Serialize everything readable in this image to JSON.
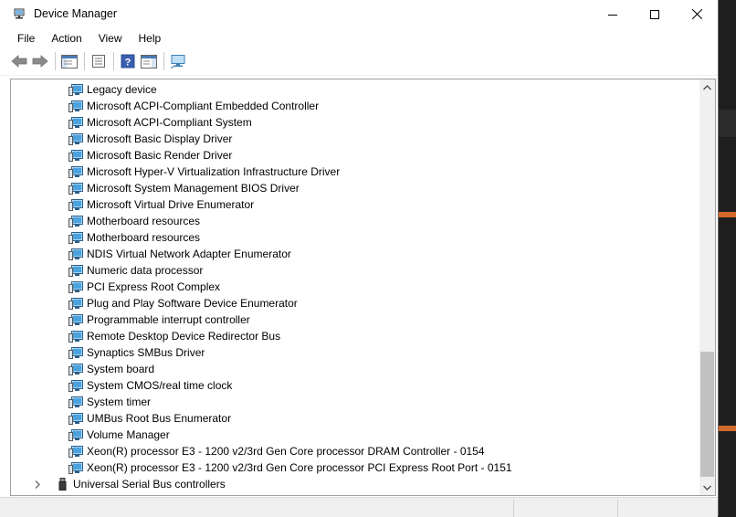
{
  "window": {
    "title": "Device Manager"
  },
  "menu": [
    "File",
    "Action",
    "View",
    "Help"
  ],
  "toolbar": [
    {
      "name": "back-icon"
    },
    {
      "name": "forward-icon"
    },
    {
      "name": "show-hide-console-tree-icon"
    },
    {
      "name": "properties-icon"
    },
    {
      "name": "help-icon"
    },
    {
      "name": "action-pane-icon"
    },
    {
      "name": "scan-hardware-changes-icon"
    }
  ],
  "devices": [
    "Legacy device",
    "Microsoft ACPI-Compliant Embedded Controller",
    "Microsoft ACPI-Compliant System",
    "Microsoft Basic Display Driver",
    "Microsoft Basic Render Driver",
    "Microsoft Hyper-V Virtualization Infrastructure Driver",
    "Microsoft System Management BIOS Driver",
    "Microsoft Virtual Drive Enumerator",
    "Motherboard resources",
    "Motherboard resources",
    "NDIS Virtual Network Adapter Enumerator",
    "Numeric data processor",
    "PCI Express Root Complex",
    "Plug and Play Software Device Enumerator",
    "Programmable interrupt controller",
    "Remote Desktop Device Redirector Bus",
    "Synaptics SMBus Driver",
    "System board",
    "System CMOS/real time clock",
    "System timer",
    "UMBus Root Bus Enumerator",
    "Volume Manager",
    "Xeon(R) processor E3 - 1200 v2/3rd Gen Core processor DRAM Controller - 0154",
    "Xeon(R) processor E3 - 1200 v2/3rd Gen Core processor PCI Express Root Port - 0151"
  ],
  "category_next": {
    "label": "Universal Serial Bus controllers",
    "expanded": false,
    "icon": "usb-icon"
  },
  "scrollbar": {
    "position_fraction": 1.0
  }
}
